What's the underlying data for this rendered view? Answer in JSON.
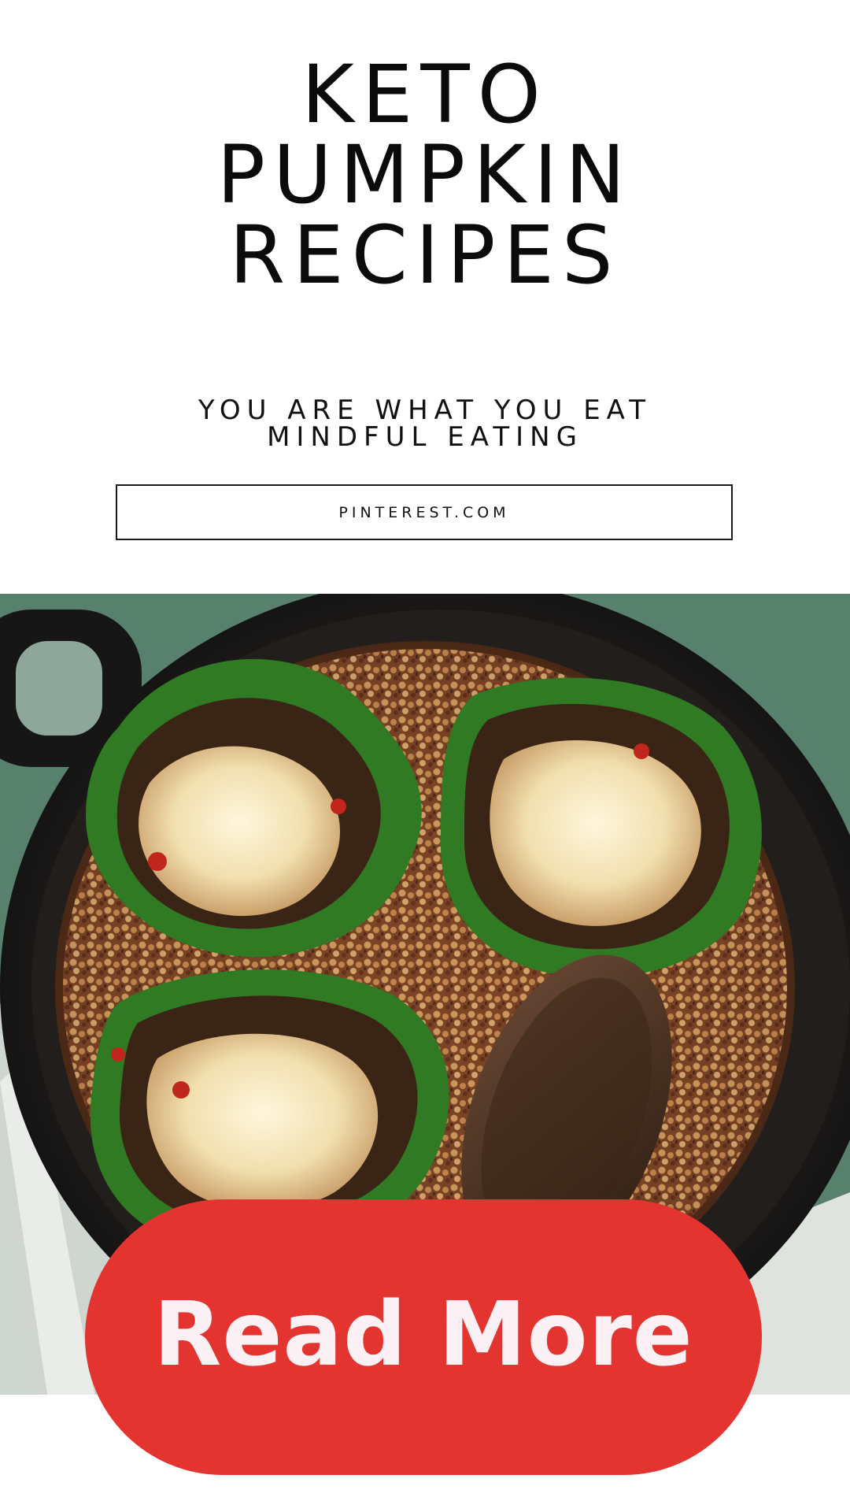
{
  "header": {
    "title_lines": [
      "KETO",
      "PUMPKIN",
      "RECIPES"
    ],
    "subtitle_lines": [
      "YOU ARE WHAT YOU EAT",
      "MINDFUL EATING"
    ]
  },
  "source": {
    "label": "PINTEREST.COM"
  },
  "photo": {
    "subject": "stuffed-peppers-in-cast-iron-skillet"
  },
  "cta": {
    "label": "Read More"
  },
  "colors": {
    "button": "#e43430",
    "button_text": "#fbf1f4",
    "text": "#111111",
    "background": "#ffffff"
  }
}
